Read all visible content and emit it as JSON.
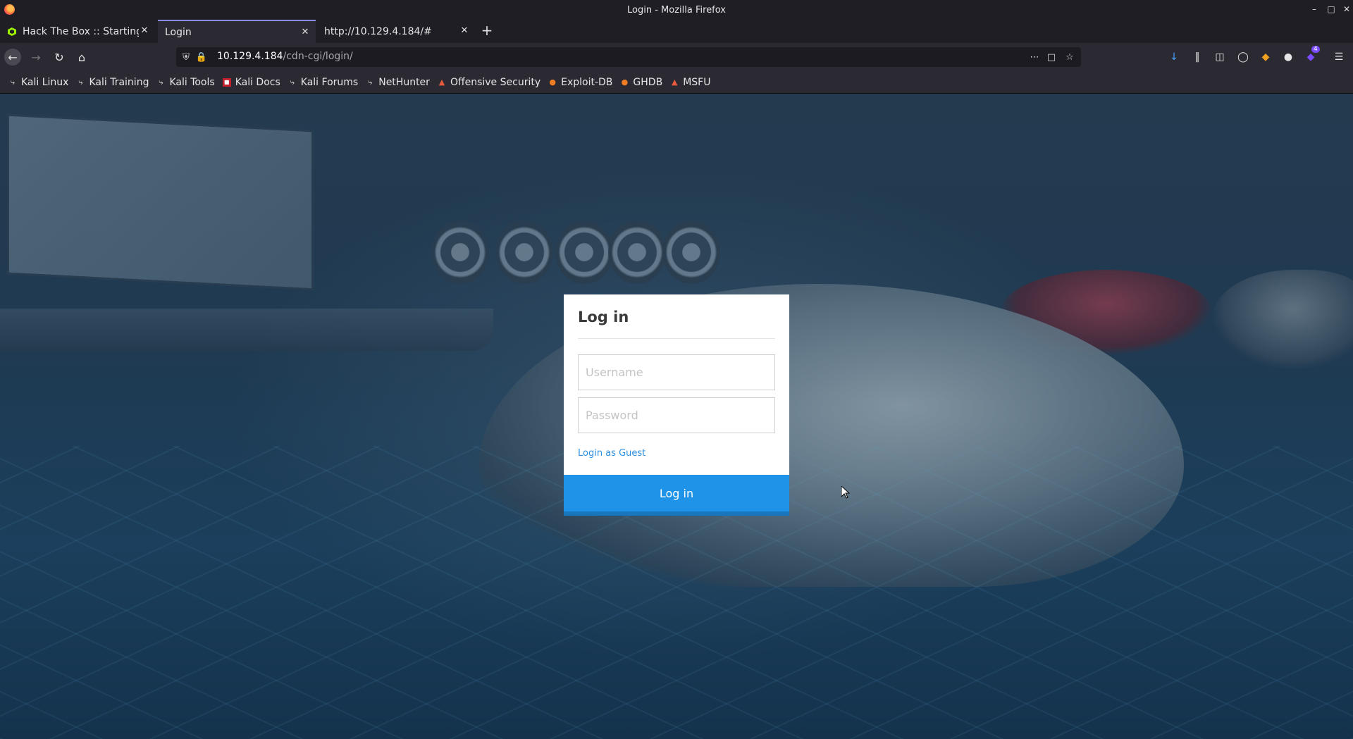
{
  "window": {
    "title": "Login - Mozilla Firefox"
  },
  "tabs": [
    {
      "title": "Hack The Box :: Starting Po",
      "active": false,
      "favicon": "htb-cube-icon"
    },
    {
      "title": "Login",
      "active": true
    },
    {
      "title": "http://10.129.4.184/#",
      "active": false
    }
  ],
  "navbar": {
    "url_host": "10.129.4.184",
    "url_path": "/cdn-cgi/login/",
    "extensions_badge": "4"
  },
  "bookmarks": [
    {
      "label": "Kali Linux",
      "icon": "kali-dragon-icon"
    },
    {
      "label": "Kali Training",
      "icon": "kali-dragon-icon"
    },
    {
      "label": "Kali Tools",
      "icon": "kali-dragon-icon"
    },
    {
      "label": "Kali Docs",
      "icon": "kali-docs-icon"
    },
    {
      "label": "Kali Forums",
      "icon": "kali-dragon-icon"
    },
    {
      "label": "NetHunter",
      "icon": "kali-dragon-icon"
    },
    {
      "label": "Offensive Security",
      "icon": "offsec-icon"
    },
    {
      "label": "Exploit-DB",
      "icon": "exploit-db-icon"
    },
    {
      "label": "GHDB",
      "icon": "exploit-db-icon"
    },
    {
      "label": "MSFU",
      "icon": "offsec-icon"
    }
  ],
  "login": {
    "title": "Log in",
    "username_placeholder": "Username",
    "password_placeholder": "Password",
    "guest_link": "Login as Guest",
    "submit_label": "Log in"
  },
  "colors": {
    "accent": "#1f93e8",
    "link": "#2c8fe0"
  }
}
